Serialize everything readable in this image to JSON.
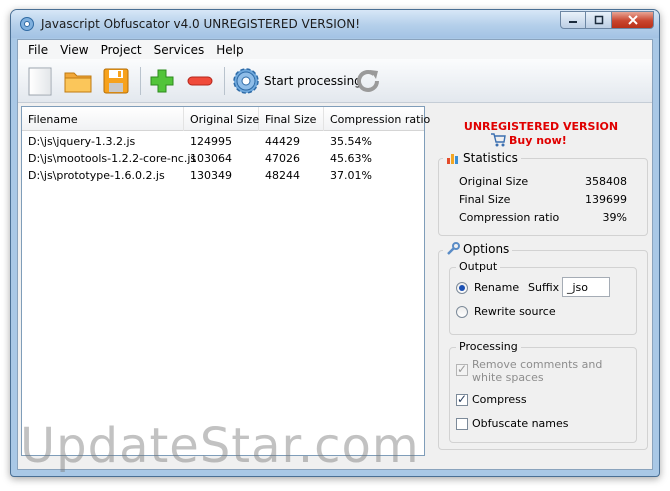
{
  "window": {
    "title": "Javascript Obfuscator v4.0  UNREGISTERED VERSION!"
  },
  "menu": [
    "File",
    "View",
    "Project",
    "Services",
    "Help"
  ],
  "toolbar": {
    "new_icon": "blank-page-icon",
    "open_icon": "folder-icon",
    "save_icon": "floppy-disk-icon",
    "add_icon": "plus-icon",
    "remove_icon": "minus-icon",
    "start_label": "Start processing",
    "refresh_icon": "refresh-icon"
  },
  "files": {
    "columns": [
      "Filename",
      "Original Size",
      "Final Size",
      "Compression ratio"
    ],
    "rows": [
      {
        "filename": "D:\\js\\jquery-1.3.2.js",
        "original": "124995",
        "final": "44429",
        "ratio": "35.54%"
      },
      {
        "filename": "D:\\js\\mootools-1.2.2-core-nc.js",
        "original": "103064",
        "final": "47026",
        "ratio": "45.63%"
      },
      {
        "filename": "D:\\js\\prototype-1.6.0.2.js",
        "original": "130349",
        "final": "48244",
        "ratio": "37.01%"
      }
    ]
  },
  "registration": {
    "unregistered": "UNREGISTERED VERSION",
    "buy_now": "Buy now!"
  },
  "statistics": {
    "title": "Statistics",
    "items": [
      {
        "label": "Original Size",
        "value": "358408"
      },
      {
        "label": "Final Size",
        "value": "139699"
      },
      {
        "label": "Compression ratio",
        "value": "39%"
      }
    ]
  },
  "options": {
    "title": "Options",
    "output": {
      "title": "Output",
      "rename_label": "Rename",
      "suffix_label": "Suffix",
      "suffix_value": "_jso",
      "rewrite_label": "Rewrite source",
      "selected": "rename"
    },
    "processing": {
      "title": "Processing",
      "remove_comments_line1": "Remove comments and",
      "remove_comments_line2": "white spaces",
      "compress_label": "Compress",
      "obfuscate_label": "Obfuscate names",
      "remove_comments_checked": true,
      "compress_checked": true,
      "obfuscate_checked": false
    }
  },
  "watermark": "UpdateStar.com",
  "colors": {
    "accent_red": "#e00000",
    "window_frame": "#a9c8e6"
  }
}
